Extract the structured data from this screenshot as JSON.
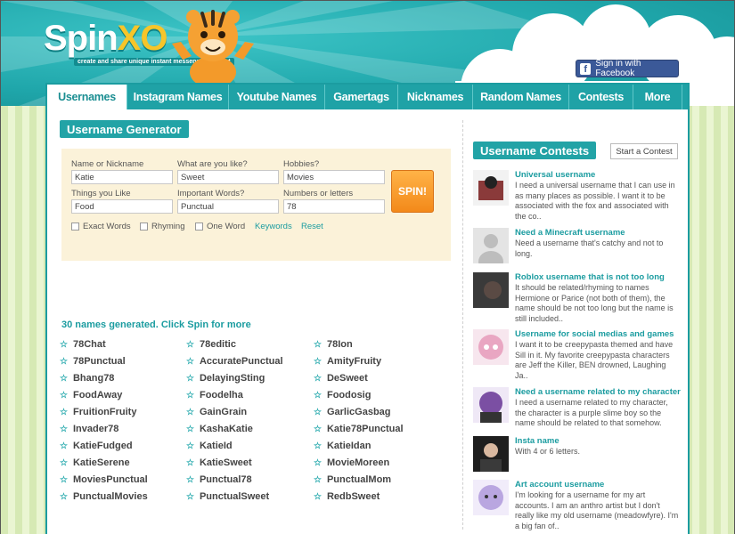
{
  "header": {
    "logo_main": "Spin",
    "logo_accent": "XO",
    "tagline": "create and share unique instant messenger content",
    "facebook_button": "Sign in with Facebook"
  },
  "nav": {
    "tabs": [
      "Usernames",
      "Instagram Names",
      "Youtube Names",
      "Gamertags",
      "Nicknames",
      "Random Names",
      "Contests",
      "More"
    ]
  },
  "generator": {
    "title": "Username Generator",
    "fields": [
      {
        "label": "Name or Nickname",
        "value": "Katie"
      },
      {
        "label": "What are you like?",
        "value": "Sweet"
      },
      {
        "label": "Hobbies?",
        "value": "Movies"
      },
      {
        "label": "Things you Like",
        "value": "Food"
      },
      {
        "label": "Important Words?",
        "value": "Punctual"
      },
      {
        "label": "Numbers or letters",
        "value": "78"
      }
    ],
    "spin_label": "SPIN!",
    "options": [
      "Exact Words",
      "Rhyming",
      "One Word"
    ],
    "keywords_link": "Keywords",
    "reset_link": "Reset"
  },
  "results": {
    "count_text": "30 names generated. Click Spin for more",
    "columns": [
      [
        "78Chat",
        "78Punctual",
        "Bhang78",
        "FoodAway",
        "FruitionFruity",
        "Invader78",
        "KatieFudged",
        "KatieSerene",
        "MoviesPunctual",
        "PunctualMovies"
      ],
      [
        "78editic",
        "AccuratePunctual",
        "DelayingSting",
        "Foodelha",
        "GainGrain",
        "KashaKatie",
        "KatieId",
        "KatieSweet",
        "Punctual78",
        "PunctualSweet"
      ],
      [
        "78Ion",
        "AmityFruity",
        "DeSweet",
        "Foodosig",
        "GarlicGasbag",
        "Katie78Punctual",
        "KatieIdan",
        "MovieMoreen",
        "PunctualMom",
        "RedbSweet"
      ]
    ]
  },
  "contests": {
    "title": "Username Contests",
    "start_button": "Start a Contest",
    "items": [
      {
        "title": "Universal username",
        "desc": "I need a universal username that I can use in as many places as possible. I want it to be associated with the fox and associated with the co..",
        "thumb_color": "#8a3a3a"
      },
      {
        "title": "Need a Minecraft username",
        "desc": "Need a username that's catchy and not to long.",
        "thumb_color": "#d8d8d8"
      },
      {
        "title": "Roblox username that is not too long",
        "desc": "It should be related/rhyming to names Hermione or Parice (not both of them), the name should be not too long but the name is still included..",
        "thumb_color": "#3a3a3a"
      },
      {
        "title": "Username for social medias and games",
        "desc": "I want it to be creepypasta themed and have Sill in it. My favorite creepypasta characters are Jeff the Killer, BEN drowned, Laughing Ja..",
        "thumb_color": "#e9a6c2"
      },
      {
        "title": "Need a username related to my character",
        "desc": "I need a username related to my character, the character is a purple slime boy so the name should be related to that somehow.",
        "thumb_color": "#7b4fa3"
      },
      {
        "title": "Insta name",
        "desc": "With 4 or 6 letters.",
        "thumb_color": "#1e1e1e"
      },
      {
        "title": "Art account username",
        "desc": "I'm looking for a username for my art accounts. I am an anthro artist but I don't really like my old username (meadowfyre). I'm a big fan of..",
        "thumb_color": "#b9a6e0"
      }
    ]
  },
  "colors": {
    "teal": "#1fa2a6",
    "orange": "#f3891a",
    "facebook": "#3b5998"
  }
}
